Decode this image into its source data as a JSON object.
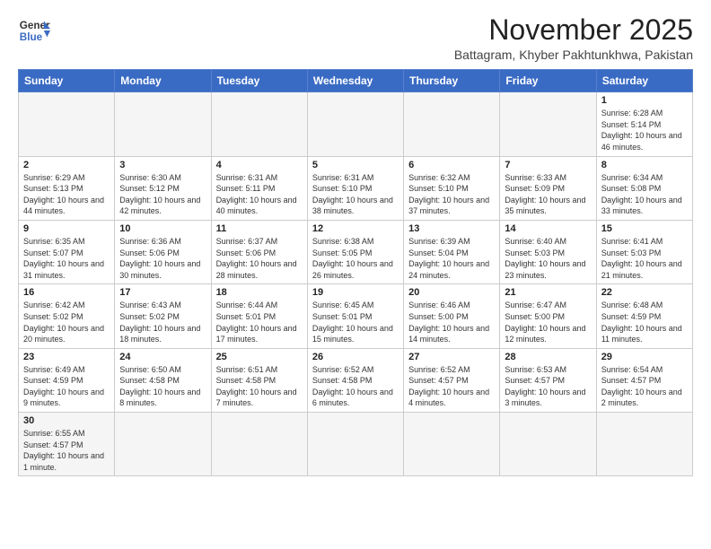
{
  "logo": {
    "line1": "General",
    "line2": "Blue"
  },
  "title": "November 2025",
  "location": "Battagram, Khyber Pakhtunkhwa, Pakistan",
  "weekdays": [
    "Sunday",
    "Monday",
    "Tuesday",
    "Wednesday",
    "Thursday",
    "Friday",
    "Saturday"
  ],
  "weeks": [
    [
      {
        "day": "",
        "info": ""
      },
      {
        "day": "",
        "info": ""
      },
      {
        "day": "",
        "info": ""
      },
      {
        "day": "",
        "info": ""
      },
      {
        "day": "",
        "info": ""
      },
      {
        "day": "",
        "info": ""
      },
      {
        "day": "1",
        "info": "Sunrise: 6:28 AM\nSunset: 5:14 PM\nDaylight: 10 hours and 46 minutes."
      }
    ],
    [
      {
        "day": "2",
        "info": "Sunrise: 6:29 AM\nSunset: 5:13 PM\nDaylight: 10 hours and 44 minutes."
      },
      {
        "day": "3",
        "info": "Sunrise: 6:30 AM\nSunset: 5:12 PM\nDaylight: 10 hours and 42 minutes."
      },
      {
        "day": "4",
        "info": "Sunrise: 6:31 AM\nSunset: 5:11 PM\nDaylight: 10 hours and 40 minutes."
      },
      {
        "day": "5",
        "info": "Sunrise: 6:31 AM\nSunset: 5:10 PM\nDaylight: 10 hours and 38 minutes."
      },
      {
        "day": "6",
        "info": "Sunrise: 6:32 AM\nSunset: 5:10 PM\nDaylight: 10 hours and 37 minutes."
      },
      {
        "day": "7",
        "info": "Sunrise: 6:33 AM\nSunset: 5:09 PM\nDaylight: 10 hours and 35 minutes."
      },
      {
        "day": "8",
        "info": "Sunrise: 6:34 AM\nSunset: 5:08 PM\nDaylight: 10 hours and 33 minutes."
      }
    ],
    [
      {
        "day": "9",
        "info": "Sunrise: 6:35 AM\nSunset: 5:07 PM\nDaylight: 10 hours and 31 minutes."
      },
      {
        "day": "10",
        "info": "Sunrise: 6:36 AM\nSunset: 5:06 PM\nDaylight: 10 hours and 30 minutes."
      },
      {
        "day": "11",
        "info": "Sunrise: 6:37 AM\nSunset: 5:06 PM\nDaylight: 10 hours and 28 minutes."
      },
      {
        "day": "12",
        "info": "Sunrise: 6:38 AM\nSunset: 5:05 PM\nDaylight: 10 hours and 26 minutes."
      },
      {
        "day": "13",
        "info": "Sunrise: 6:39 AM\nSunset: 5:04 PM\nDaylight: 10 hours and 24 minutes."
      },
      {
        "day": "14",
        "info": "Sunrise: 6:40 AM\nSunset: 5:03 PM\nDaylight: 10 hours and 23 minutes."
      },
      {
        "day": "15",
        "info": "Sunrise: 6:41 AM\nSunset: 5:03 PM\nDaylight: 10 hours and 21 minutes."
      }
    ],
    [
      {
        "day": "16",
        "info": "Sunrise: 6:42 AM\nSunset: 5:02 PM\nDaylight: 10 hours and 20 minutes."
      },
      {
        "day": "17",
        "info": "Sunrise: 6:43 AM\nSunset: 5:02 PM\nDaylight: 10 hours and 18 minutes."
      },
      {
        "day": "18",
        "info": "Sunrise: 6:44 AM\nSunset: 5:01 PM\nDaylight: 10 hours and 17 minutes."
      },
      {
        "day": "19",
        "info": "Sunrise: 6:45 AM\nSunset: 5:01 PM\nDaylight: 10 hours and 15 minutes."
      },
      {
        "day": "20",
        "info": "Sunrise: 6:46 AM\nSunset: 5:00 PM\nDaylight: 10 hours and 14 minutes."
      },
      {
        "day": "21",
        "info": "Sunrise: 6:47 AM\nSunset: 5:00 PM\nDaylight: 10 hours and 12 minutes."
      },
      {
        "day": "22",
        "info": "Sunrise: 6:48 AM\nSunset: 4:59 PM\nDaylight: 10 hours and 11 minutes."
      }
    ],
    [
      {
        "day": "23",
        "info": "Sunrise: 6:49 AM\nSunset: 4:59 PM\nDaylight: 10 hours and 9 minutes."
      },
      {
        "day": "24",
        "info": "Sunrise: 6:50 AM\nSunset: 4:58 PM\nDaylight: 10 hours and 8 minutes."
      },
      {
        "day": "25",
        "info": "Sunrise: 6:51 AM\nSunset: 4:58 PM\nDaylight: 10 hours and 7 minutes."
      },
      {
        "day": "26",
        "info": "Sunrise: 6:52 AM\nSunset: 4:58 PM\nDaylight: 10 hours and 6 minutes."
      },
      {
        "day": "27",
        "info": "Sunrise: 6:52 AM\nSunset: 4:57 PM\nDaylight: 10 hours and 4 minutes."
      },
      {
        "day": "28",
        "info": "Sunrise: 6:53 AM\nSunset: 4:57 PM\nDaylight: 10 hours and 3 minutes."
      },
      {
        "day": "29",
        "info": "Sunrise: 6:54 AM\nSunset: 4:57 PM\nDaylight: 10 hours and 2 minutes."
      }
    ],
    [
      {
        "day": "30",
        "info": "Sunrise: 6:55 AM\nSunset: 4:57 PM\nDaylight: 10 hours and 1 minute."
      },
      {
        "day": "",
        "info": ""
      },
      {
        "day": "",
        "info": ""
      },
      {
        "day": "",
        "info": ""
      },
      {
        "day": "",
        "info": ""
      },
      {
        "day": "",
        "info": ""
      },
      {
        "day": "",
        "info": ""
      }
    ]
  ]
}
